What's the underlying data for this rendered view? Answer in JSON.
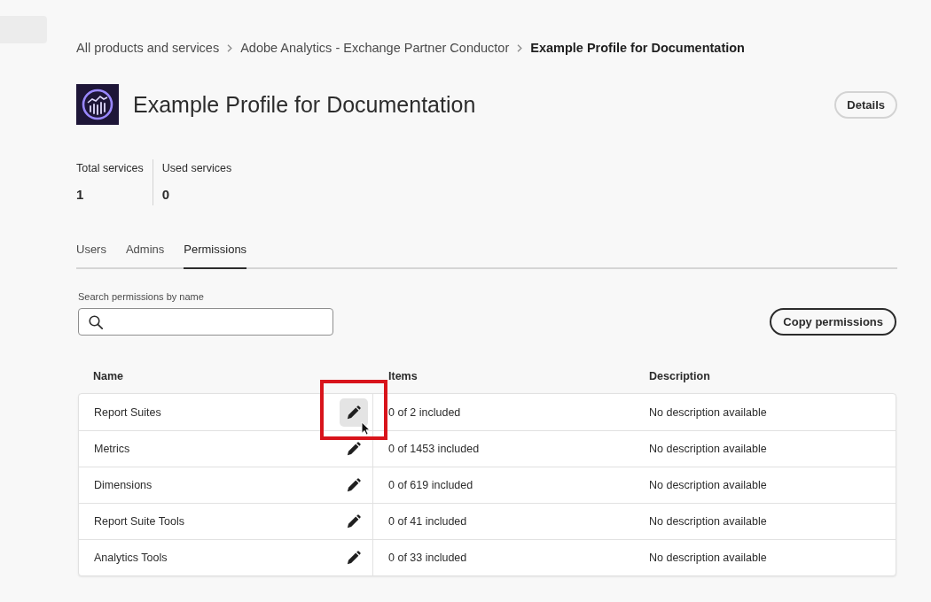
{
  "breadcrumb": [
    {
      "label": "All products and services",
      "current": false
    },
    {
      "label": "Adobe Analytics - Exchange Partner Conductor",
      "current": false
    },
    {
      "label": "Example Profile for Documentation",
      "current": true
    }
  ],
  "header": {
    "title": "Example Profile for Documentation",
    "button": "Details"
  },
  "stats": [
    {
      "label": "Total services",
      "value": "1"
    },
    {
      "label": "Used services",
      "value": "0"
    }
  ],
  "tabs": [
    {
      "label": "Users",
      "selected": false
    },
    {
      "label": "Admins",
      "selected": false
    },
    {
      "label": "Permissions",
      "selected": true
    }
  ],
  "search": {
    "label": "Search permissions by name"
  },
  "copy_button": "Copy permissions",
  "table": {
    "columns": [
      "Name",
      "Items",
      "Description"
    ],
    "rows": [
      {
        "name": "Report Suites",
        "items": "0 of 2 included",
        "description": "No description available",
        "hovered": true,
        "annotated": true
      },
      {
        "name": "Metrics",
        "items": "0 of 1453 included",
        "description": "No description available",
        "hovered": false,
        "annotated": false
      },
      {
        "name": "Dimensions",
        "items": "0 of 619 included",
        "description": "No description available",
        "hovered": false,
        "annotated": false
      },
      {
        "name": "Report Suite Tools",
        "items": "0 of 41 included",
        "description": "No description available",
        "hovered": false,
        "annotated": false
      },
      {
        "name": "Analytics Tools",
        "items": "0 of 33 included",
        "description": "No description available",
        "hovered": false,
        "annotated": false
      }
    ]
  }
}
